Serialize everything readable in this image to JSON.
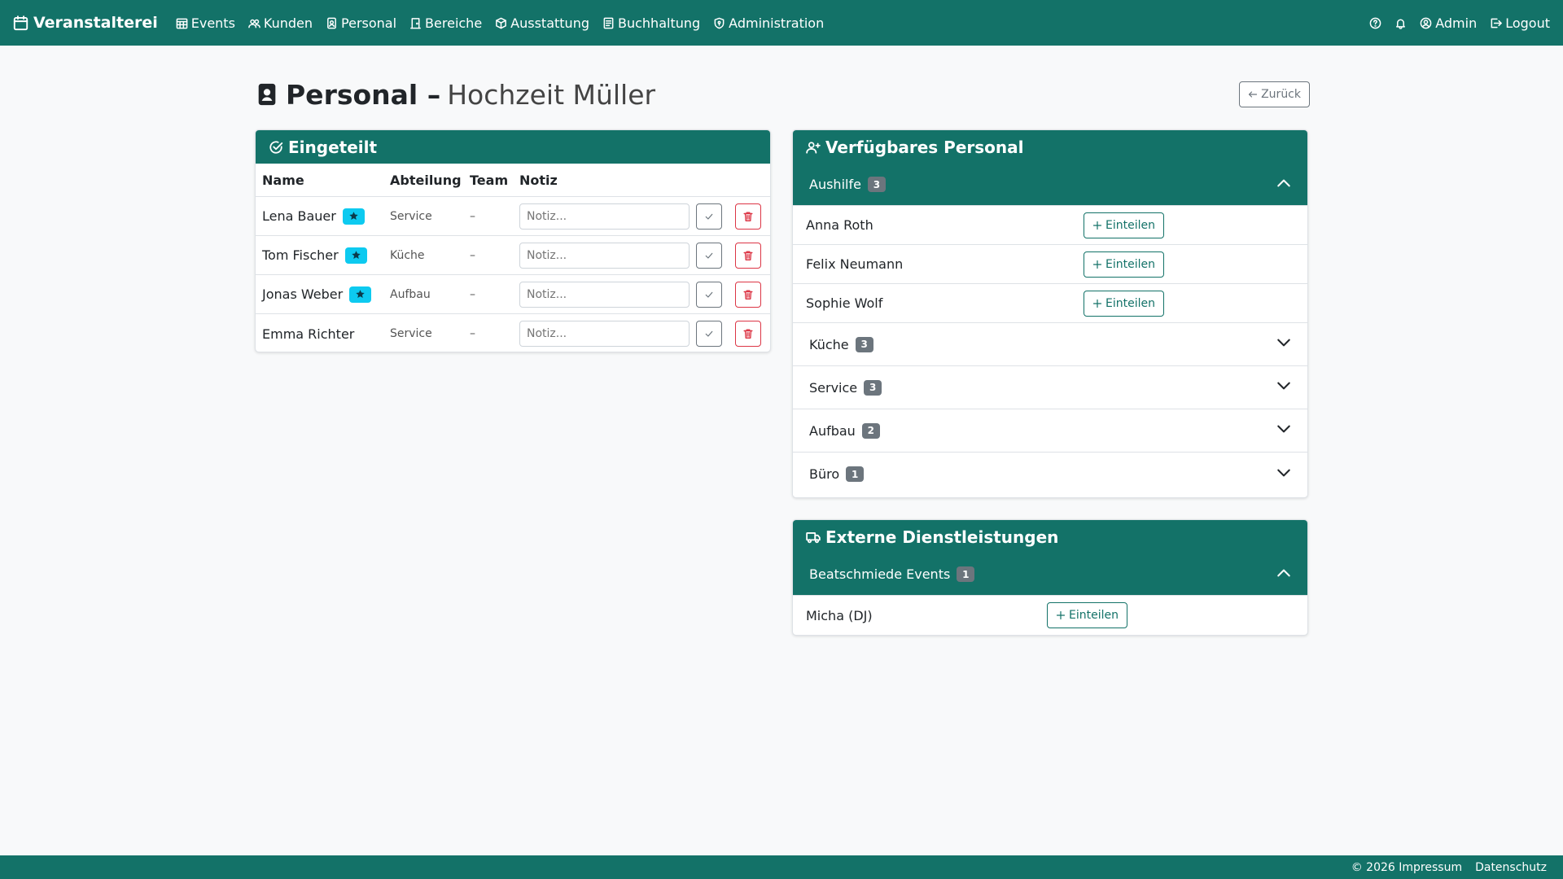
{
  "nav": {
    "brand": "Veranstalterei",
    "items": [
      {
        "label": "Events",
        "icon": "calendar-grid-icon"
      },
      {
        "label": "Kunden",
        "icon": "people-icon"
      },
      {
        "label": "Personal",
        "icon": "badge-icon"
      },
      {
        "label": "Bereiche",
        "icon": "door-icon"
      },
      {
        "label": "Ausstattung",
        "icon": "box-icon"
      },
      {
        "label": "Buchhaltung",
        "icon": "ledger-icon"
      },
      {
        "label": "Administration",
        "icon": "shield-icon"
      }
    ],
    "right": {
      "help_icon": "question-circle-icon",
      "bell_icon": "bell-icon",
      "user_label": "Admin",
      "logout_label": "Logout"
    }
  },
  "page": {
    "title_strong": "Personal –",
    "title_sub": "Hochzeit Müller",
    "back_label": "Zurück"
  },
  "assigned": {
    "header": "Eingeteilt",
    "columns": [
      "Name",
      "Abteilung",
      "Team",
      "Notiz"
    ],
    "notiz_placeholder": "Notiz...",
    "rows": [
      {
        "name": "Lena Bauer",
        "starred": true,
        "abteilung": "Service",
        "team": "–"
      },
      {
        "name": "Tom Fischer",
        "starred": true,
        "abteilung": "Küche",
        "team": "–"
      },
      {
        "name": "Jonas Weber",
        "starred": true,
        "abteilung": "Aufbau",
        "team": "–"
      },
      {
        "name": "Emma Richter",
        "starred": false,
        "abteilung": "Service",
        "team": "–"
      }
    ]
  },
  "available": {
    "header": "Verfügbares Personal",
    "assign_label": "Einteilen",
    "groups": [
      {
        "name": "Aushilfe",
        "count": "3",
        "open": true,
        "members": [
          "Anna Roth",
          "Felix Neumann",
          "Sophie Wolf"
        ]
      },
      {
        "name": "Küche",
        "count": "3",
        "open": false,
        "members": []
      },
      {
        "name": "Service",
        "count": "3",
        "open": false,
        "members": []
      },
      {
        "name": "Aufbau",
        "count": "2",
        "open": false,
        "members": []
      },
      {
        "name": "Büro",
        "count": "1",
        "open": false,
        "members": []
      }
    ]
  },
  "external": {
    "header": "Externe Dienstleistungen",
    "assign_label": "Einteilen",
    "groups": [
      {
        "name": "Beatschmiede Events",
        "count": "1",
        "open": true,
        "members": [
          "Micha (DJ)"
        ]
      }
    ]
  },
  "footer": {
    "copyright": "© 2026 Impressum",
    "privacy": "Datenschutz"
  },
  "colors": {
    "primary": "#137268",
    "star_badge": "#0dcaf0",
    "danger": "#dc3545",
    "secondary": "#6c757d"
  }
}
